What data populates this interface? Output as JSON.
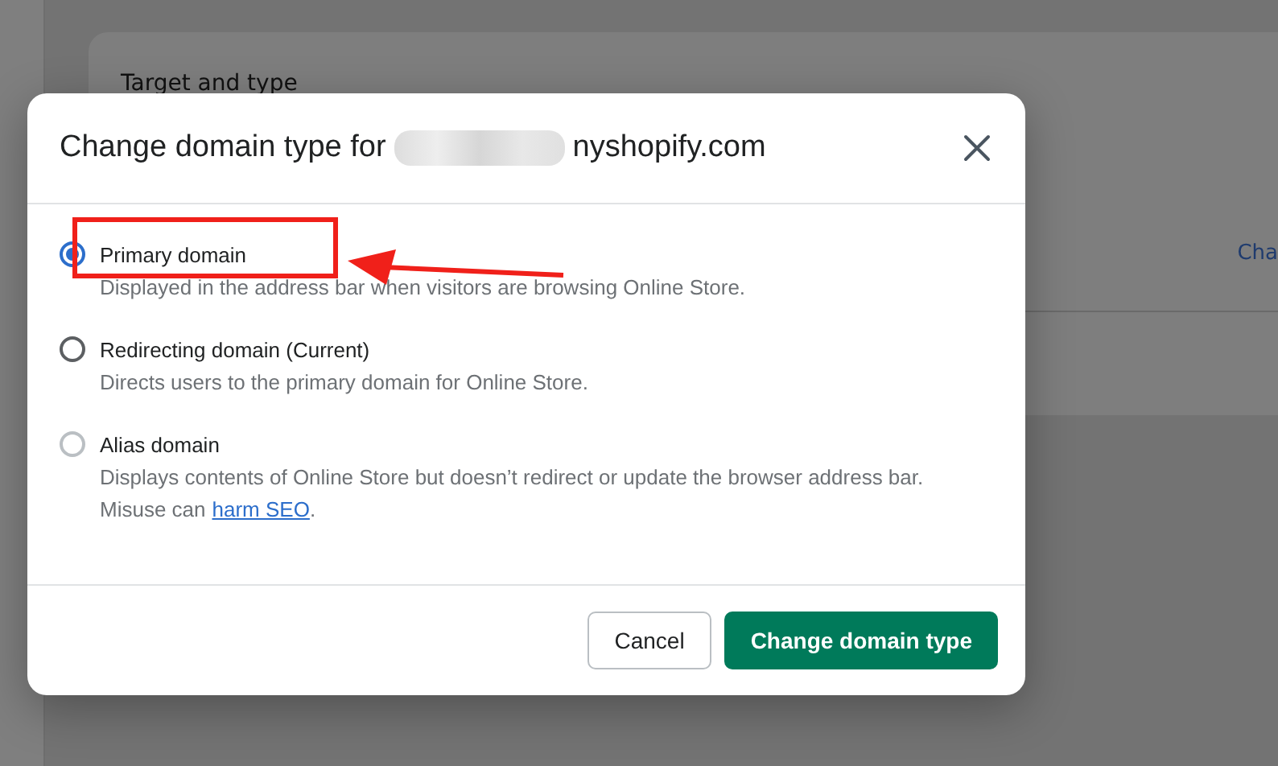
{
  "background": {
    "card_title": "Target and type",
    "side_link": "Cha"
  },
  "dialog": {
    "title_prefix": "Change domain type for",
    "title_suffix": "nyshopify.com",
    "options": [
      {
        "label": "Primary domain",
        "description": "Displayed in the address bar when visitors are browsing Online Store.",
        "selected": true,
        "disabled": false
      },
      {
        "label": "Redirecting domain (Current)",
        "description": "Directs users to the primary domain for Online Store.",
        "selected": false,
        "disabled": false
      },
      {
        "label": "Alias domain",
        "description": "Displays contents of Online Store but doesn’t redirect or update the browser address bar. Misuse can",
        "link": "harm SEO",
        "after": ".",
        "selected": false,
        "disabled": true
      }
    ],
    "buttons": [
      {
        "label": "Cancel",
        "kind": "secondary"
      },
      {
        "label": "Change domain type",
        "kind": "primary"
      }
    ]
  }
}
